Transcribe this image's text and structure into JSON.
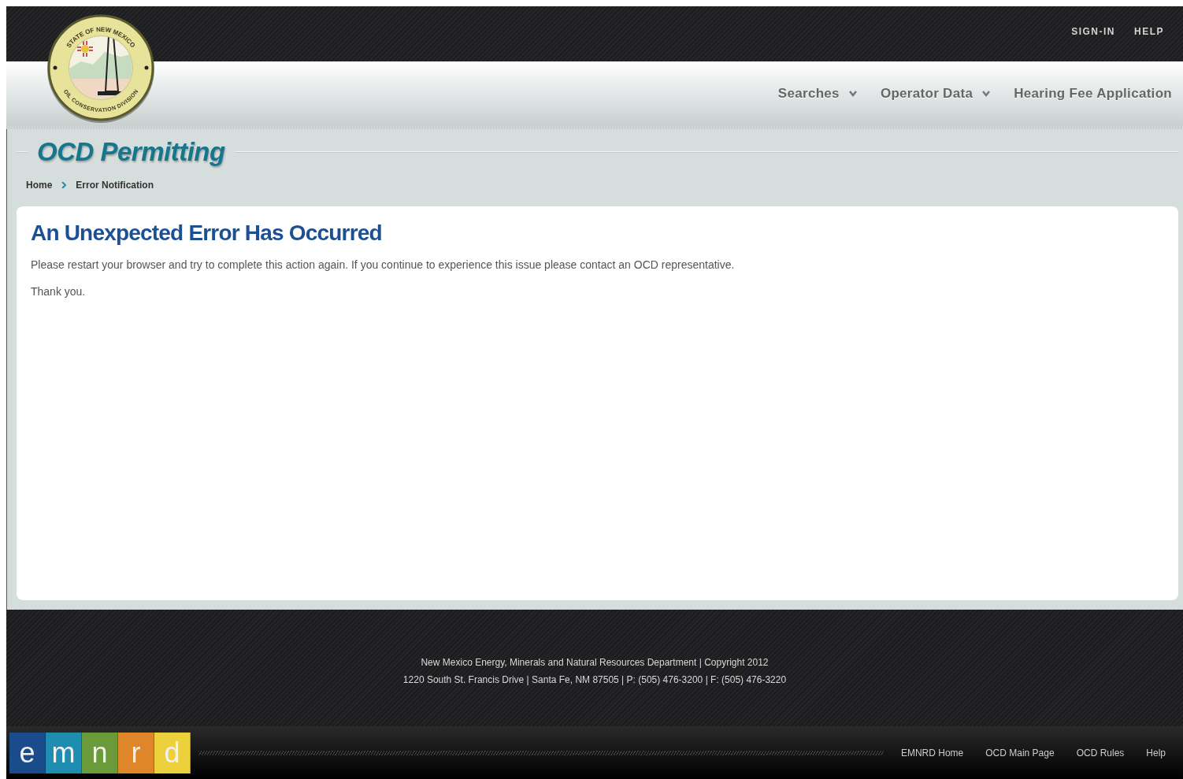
{
  "seal": {
    "top_text": "STATE OF NEW MEXICO",
    "bottom_text": "OIL CONSERVATION DIVISION"
  },
  "top_links": [
    "SIGN-IN",
    "HELP"
  ],
  "nav": [
    {
      "label": "Searches",
      "dropdown": true
    },
    {
      "label": "Operator Data",
      "dropdown": true
    },
    {
      "label": "Hearing Fee Application",
      "dropdown": false
    }
  ],
  "page_title": "OCD Permitting",
  "breadcrumb": [
    "Home",
    "Error Notification"
  ],
  "content": {
    "heading": "An Unexpected Error Has Occurred",
    "paragraphs": [
      "Please restart your browser and try to complete this action again. If you continue to experience this issue please contact an OCD representative.",
      "Thank you."
    ]
  },
  "footer": {
    "lines": [
      "New Mexico Energy, Minerals and Natural Resources Department | Copyright 2012",
      "1220 South St. Francis Drive | Santa Fe, NM 87505 | P: (505) 476-3200 | F: (505) 476-3220"
    ]
  },
  "emnrd_logo": [
    {
      "letter": "e",
      "color": "#1a4c8c"
    },
    {
      "letter": "m",
      "color": "#1e8db0"
    },
    {
      "letter": "n",
      "color": "#6a9a3a"
    },
    {
      "letter": "r",
      "color": "#e0862a"
    },
    {
      "letter": "d",
      "color": "#ecd03c"
    }
  ],
  "bottom_links": [
    "EMNRD Home",
    "OCD Main Page",
    "OCD Rules",
    "Help"
  ]
}
